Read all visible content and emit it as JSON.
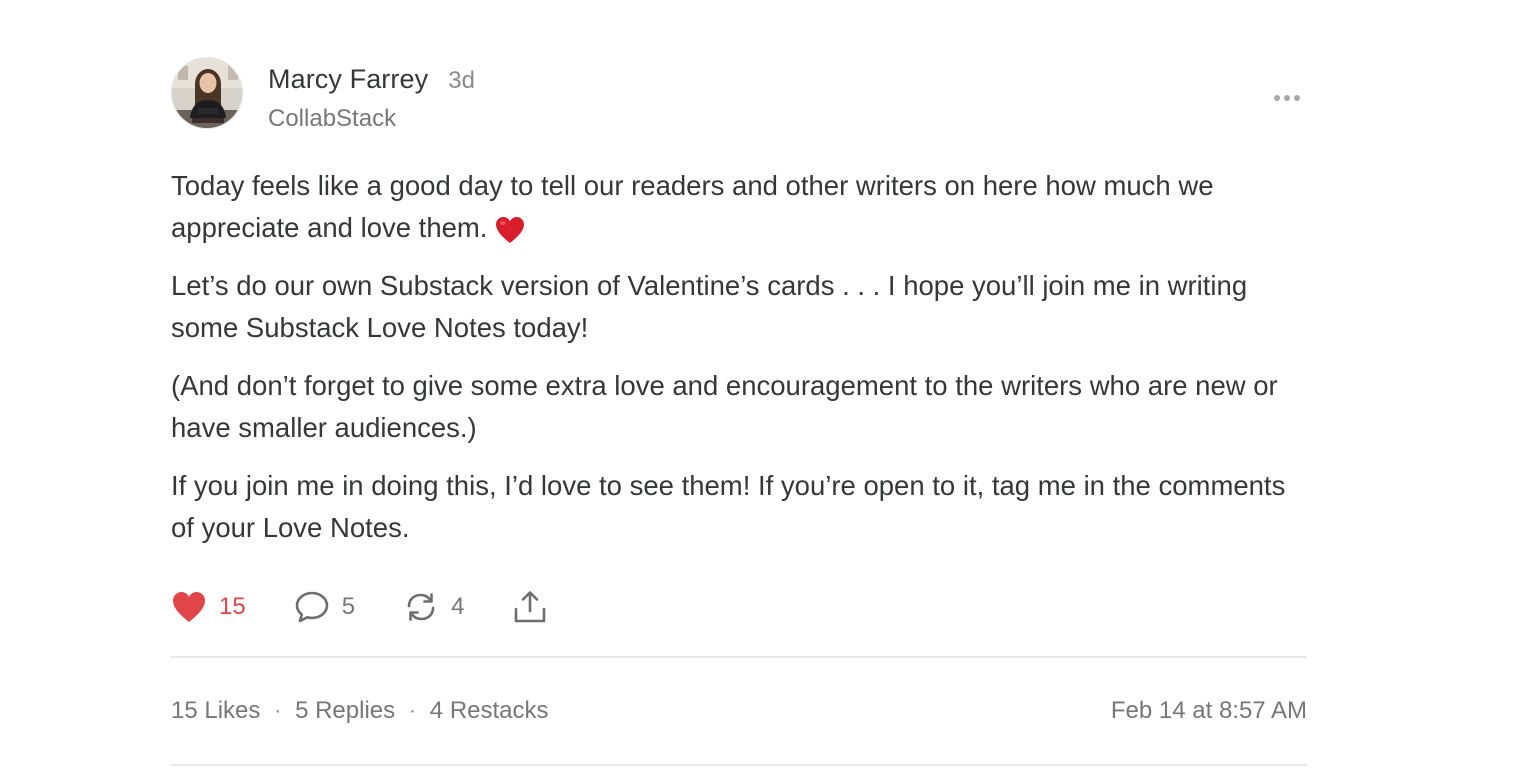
{
  "author": {
    "name": "Marcy Farrey",
    "time_ago": "3d",
    "publication": "CollabStack"
  },
  "body": {
    "paragraphs": [
      "Today feels like a good day to tell our readers and other writers on here how much we appreciate and love them.",
      "Let’s do our own Substack version of Valentine’s cards . . . I hope you’ll join me in writing some Substack Love Notes today!",
      "(And don’t forget to give some extra love and encouragement to the writers who are new or have smaller audiences.)",
      "If you join me in doing this, I’d love to see them! If you’re open to it, tag me in the comments of your Love Notes."
    ],
    "emoji": "red-heart"
  },
  "actions": {
    "likes": "15",
    "replies": "5",
    "restacks": "4",
    "liked": true
  },
  "stats": {
    "likes": "15 Likes",
    "replies": "5 Replies",
    "restacks": "4 Restacks",
    "separator": "·",
    "timestamp": "Feb 14 at 8:57 AM"
  },
  "icons": {
    "like": "heart-icon",
    "reply": "comment-icon",
    "restack": "restack-icon",
    "share": "share-icon",
    "more": "more-dots-icon"
  },
  "colors": {
    "text": "#363737",
    "muted": "#777777",
    "like_red": "#e0454a",
    "divider": "#e8e8e8"
  }
}
